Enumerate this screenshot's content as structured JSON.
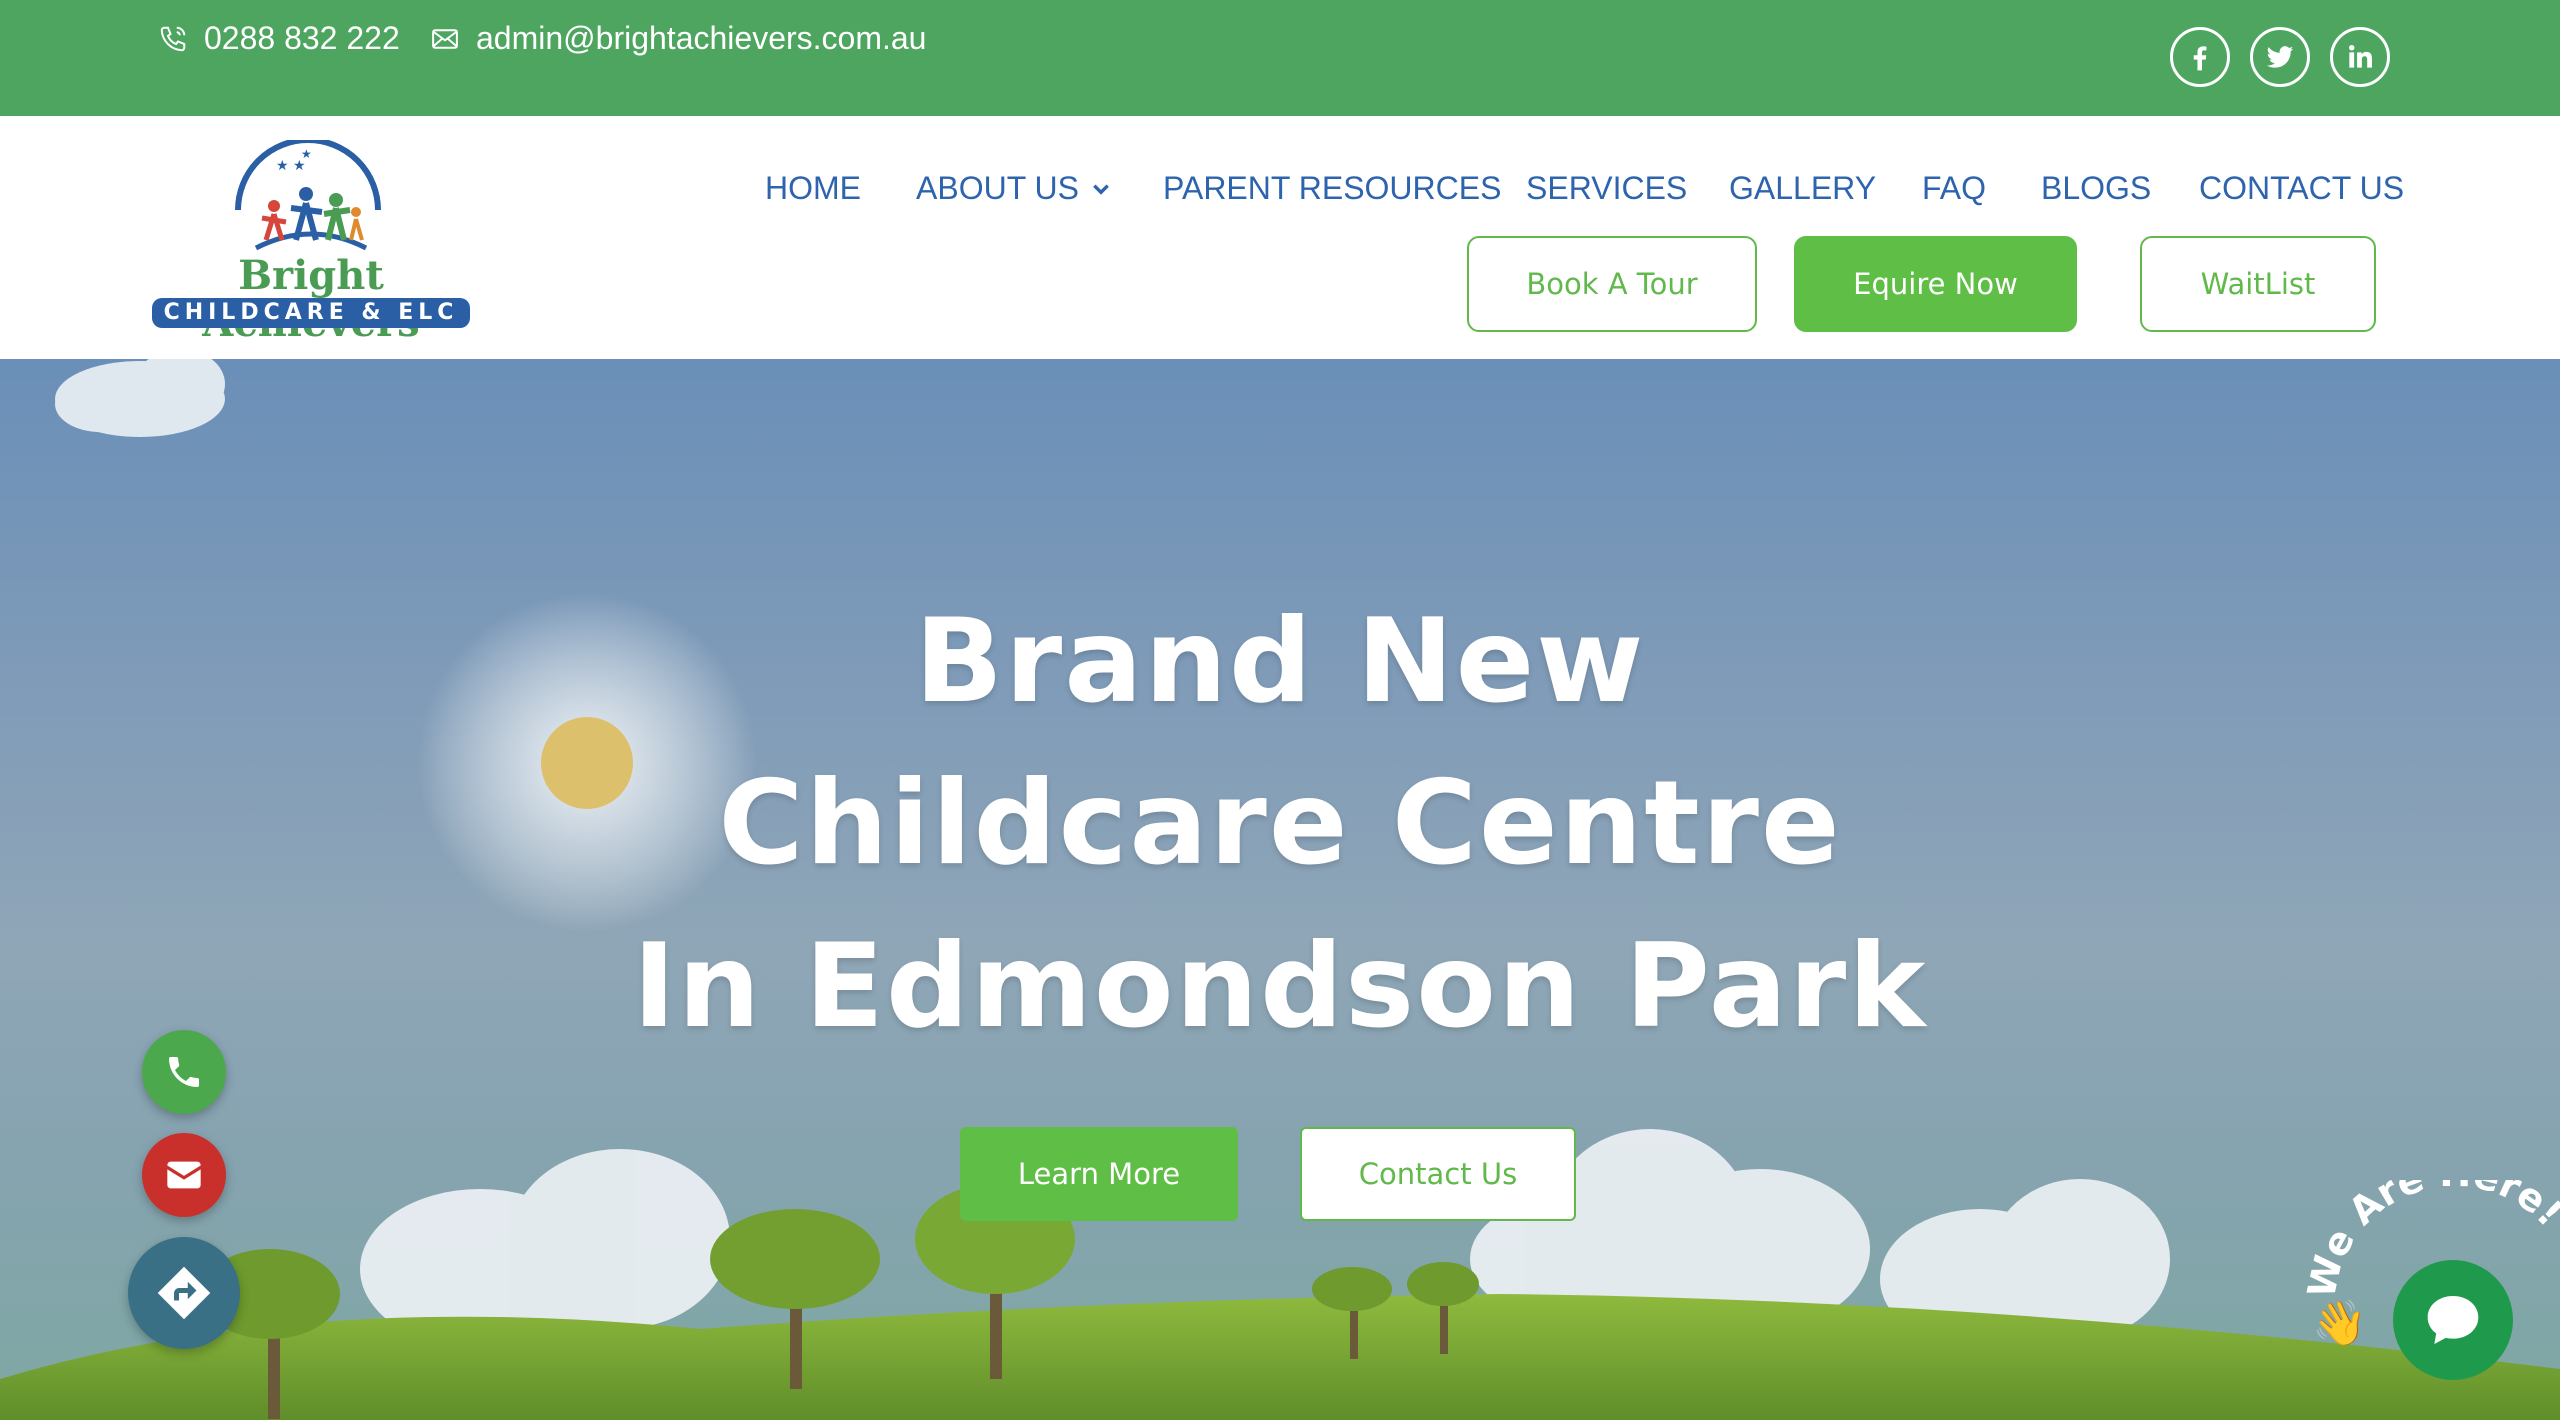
{
  "topbar": {
    "phone": "0288 832 222",
    "email": "admin@brightachievers.com.au",
    "social": [
      "facebook-icon",
      "twitter-icon",
      "linkedin-icon"
    ],
    "background": "#4ea55f"
  },
  "logo": {
    "line1": "Bright Achievers",
    "line2": "CHILDCARE & ELC"
  },
  "nav": {
    "items": [
      {
        "label": "HOME"
      },
      {
        "label": "ABOUT US"
      },
      {
        "label": "PARENT RESOURCES"
      },
      {
        "label": "SERVICES"
      },
      {
        "label": "GALLERY"
      },
      {
        "label": "FAQ"
      },
      {
        "label": "BLOGS"
      },
      {
        "label": "CONTACT US"
      }
    ],
    "color": "#2e64ad"
  },
  "header_buttons": {
    "book_tour": "Book A Tour",
    "enquire": "Equire Now",
    "waitlist": "WaitList",
    "accent": "#5fbe45"
  },
  "hero": {
    "line1": "Brand New",
    "line2": "Childcare Centre",
    "line3": "In Edmondson Park",
    "learn_more": "Learn More",
    "contact_us": "Contact Us"
  },
  "floating": {
    "phone_color": "#4ca84c",
    "email_color": "#c9302c",
    "directions_color": "#3a7086"
  },
  "chat": {
    "label": "We Are Here!",
    "color": "#1f9a4d"
  }
}
